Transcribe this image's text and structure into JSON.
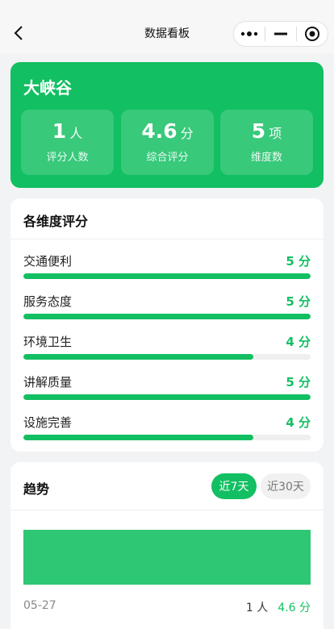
{
  "nav": {
    "title": "数据看板",
    "back_icon": "chevron-left-icon",
    "more_icon": "more-dots-icon",
    "minimize_icon": "minimize-icon",
    "close_icon": "target-icon"
  },
  "hero": {
    "name": "大峡谷",
    "stats": [
      {
        "value": "1",
        "unit": "人",
        "label": "评分人数"
      },
      {
        "value": "4.6",
        "unit": "分",
        "label": "综合评分"
      },
      {
        "value": "5",
        "unit": "项",
        "label": "维度数"
      }
    ]
  },
  "dimensions": {
    "title": "各维度评分",
    "max_score": 5,
    "items": [
      {
        "name": "交通便利",
        "score": 5,
        "score_text": "5 分"
      },
      {
        "name": "服务态度",
        "score": 5,
        "score_text": "5 分"
      },
      {
        "name": "环境卫生",
        "score": 4,
        "score_text": "4 分"
      },
      {
        "name": "讲解质量",
        "score": 5,
        "score_text": "5 分"
      },
      {
        "name": "设施完善",
        "score": 4,
        "score_text": "4 分"
      }
    ]
  },
  "trend": {
    "title": "趋势",
    "tabs": [
      {
        "label": "近7天",
        "active": true
      },
      {
        "label": "近30天",
        "active": false
      }
    ],
    "rows": [
      {
        "date": "05-27",
        "count_text": "1 人",
        "score_text": "4.6 分"
      }
    ]
  },
  "colors": {
    "accent": "#12bf62",
    "background": "#f2f3f5",
    "track": "#efefef"
  }
}
